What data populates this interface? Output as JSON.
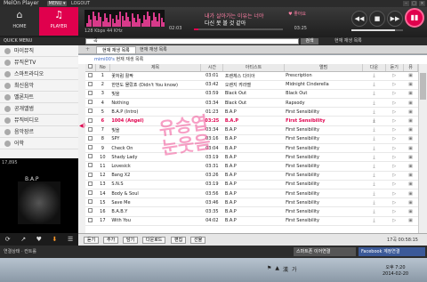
{
  "window": {
    "title": "MelOn Player",
    "menu_label": "MENU ▾",
    "logout_label": "LOGOUT",
    "buttons": [
      "–",
      "□",
      "×"
    ]
  },
  "nav": {
    "home_label": "HOME",
    "player_label": "PLAYER"
  },
  "now_playing": {
    "line1": "내가 살아가는 이유는 너야",
    "line2": "다신 못 볼 것 같아",
    "bitrate": "128 Kbps",
    "sample_rate": "44 KHz",
    "time_current": "02:03",
    "time_total": "03:25",
    "progress": 0.05,
    "heart_label": "좋아요",
    "volume": 0.85
  },
  "controls": {
    "prev": "◀◀",
    "stop": "■",
    "next": "▶▶",
    "play": "▮▮"
  },
  "search": {
    "quick_menu_label": "QUICK MENU",
    "value": "곡",
    "button": "검색",
    "back_label": "현재 재생 목록"
  },
  "sidebar": {
    "items": [
      {
        "label": "마이뮤직"
      },
      {
        "label": "뮤직온TV"
      },
      {
        "label": "스마트라디오"
      },
      {
        "label": "최신음악"
      },
      {
        "label": "멜론차트"
      },
      {
        "label": "공개앨범"
      },
      {
        "label": "뮤직비디오"
      },
      {
        "label": "음악장르"
      },
      {
        "label": "어학"
      }
    ]
  },
  "album": {
    "band": "B.A.P",
    "count": "17,895"
  },
  "album_controls": [
    "⟳",
    "↗",
    "♥",
    "⬇",
    "☰"
  ],
  "tabs": {
    "tab1": "현재 재생 목록",
    "tab2": "현재 재생 목록",
    "add": "+"
  },
  "list_title": {
    "owner": "mimi00's",
    "label": "현재 재생 목록"
  },
  "table": {
    "headers": [
      "No",
      "제목",
      "시간",
      "아티스트",
      "앨범",
      "다운",
      "듣기",
      "뮤"
    ],
    "rows": [
      {
        "no": "1",
        "title": "꽃처럼 활짝",
        "time": "03:01",
        "artist": "프렌체스 다이아",
        "album": "Prescription"
      },
      {
        "no": "2",
        "title": "한번도 몰랐죠 (Didn't You know)",
        "time": "03:42",
        "artist": "오렌지 캬라멜",
        "album": "Midnight Cinderella"
      },
      {
        "no": "3",
        "title": "빛을",
        "time": "03:59",
        "artist": "Black Out",
        "album": "Black Out"
      },
      {
        "no": "4",
        "title": "Nothing",
        "time": "03:34",
        "artist": "Black Out",
        "album": "Rapsody"
      },
      {
        "no": "5",
        "title": "B.A.P (Intro)",
        "time": "01:23",
        "artist": "B.A.P",
        "album": "First Sensibility"
      },
      {
        "no": "6",
        "title": "1004 (Angel)",
        "time": "03:25",
        "artist": "B.A.P",
        "album": "First Sensibility"
      },
      {
        "no": "7",
        "title": "빛을",
        "time": "03:34",
        "artist": "B.A.P",
        "album": "First Sensibility"
      },
      {
        "no": "8",
        "title": "SPY",
        "time": "03:16",
        "artist": "B.A.P",
        "album": "First Sensibility"
      },
      {
        "no": "9",
        "title": "Check On",
        "time": "03:04",
        "artist": "B.A.P",
        "album": "First Sensibility"
      },
      {
        "no": "10",
        "title": "Shady Lady",
        "time": "03:19",
        "artist": "B.A.P",
        "album": "First Sensibility"
      },
      {
        "no": "11",
        "title": "Lovesick",
        "time": "03:31",
        "artist": "B.A.P",
        "album": "First Sensibility"
      },
      {
        "no": "12",
        "title": "Bang X2",
        "time": "03:26",
        "artist": "B.A.P",
        "album": "First Sensibility"
      },
      {
        "no": "13",
        "title": "S.N.S",
        "time": "03:19",
        "artist": "B.A.P",
        "album": "First Sensibility"
      },
      {
        "no": "14",
        "title": "Body & Soul",
        "time": "03:56",
        "artist": "B.A.P",
        "album": "First Sensibility"
      },
      {
        "no": "15",
        "title": "Save Me",
        "time": "03:46",
        "artist": "B.A.P",
        "album": "First Sensibility"
      },
      {
        "no": "16",
        "title": "B.A.B.Y",
        "time": "03:35",
        "artist": "B.A.P",
        "album": "First Sensibility"
      },
      {
        "no": "17",
        "title": "With You",
        "time": "04:02",
        "artist": "B.A.P",
        "album": "First Sensibility"
      }
    ],
    "playing_index": 5
  },
  "bottom_buttons": [
    "듣기",
    "추가",
    "담기",
    "다운로드",
    "편집",
    "선물"
  ],
  "list_info": "17곡 00:58:15",
  "status": {
    "connection": "연결상태 · 컨트롤",
    "smartphone": "스마트폰 이어연결",
    "facebook": "Facebook 계정연결"
  },
  "watermark": {
    "line1": "유승엽",
    "line2": "눈웃음"
  },
  "clock": {
    "time": "오후 7:20",
    "date": "2014-02-20"
  },
  "tray": {
    "lang": "가",
    "ime": "漢"
  }
}
